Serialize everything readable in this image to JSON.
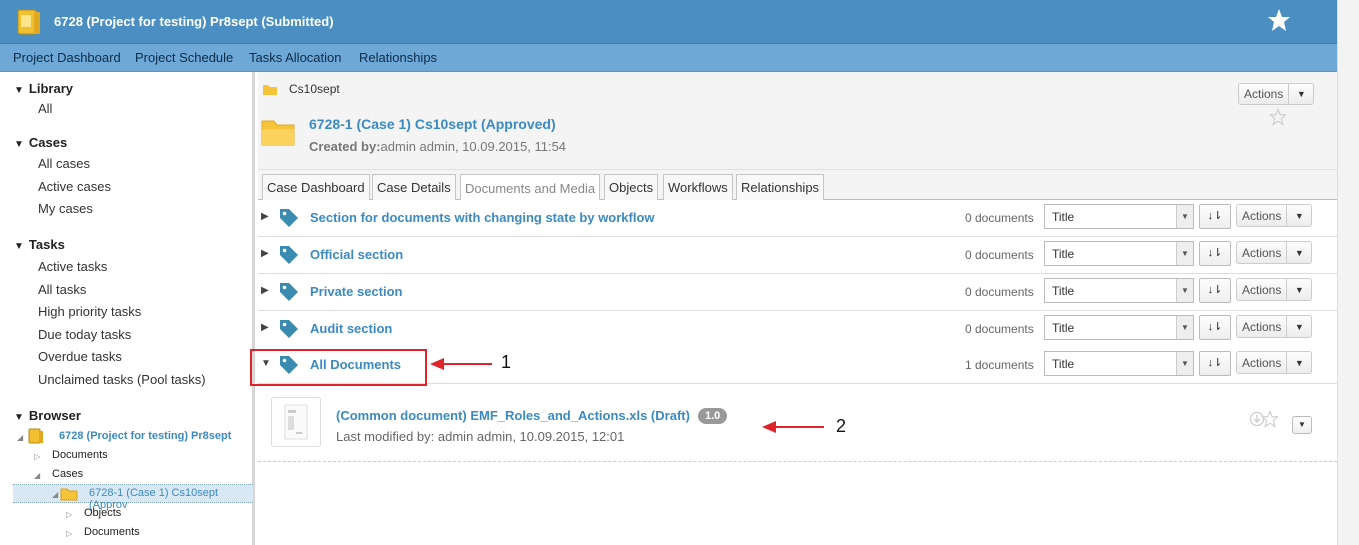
{
  "header": {
    "title": "6728 (Project for testing) Pr8sept (Submitted)"
  },
  "nav": [
    "Project Dashboard",
    "Project Schedule",
    "Tasks Allocation",
    "Relationships"
  ],
  "sidebar": {
    "library": {
      "title": "Library",
      "items": [
        "All"
      ]
    },
    "cases": {
      "title": "Cases",
      "items": [
        "All cases",
        "Active cases",
        "My cases"
      ]
    },
    "tasks": {
      "title": "Tasks",
      "items": [
        "Active tasks",
        "All tasks",
        "High priority tasks",
        "Due today tasks",
        "Overdue tasks",
        "Unclaimed tasks (Pool tasks)"
      ]
    },
    "browser": {
      "title": "Browser",
      "project": "6728 (Project for testing) Pr8sept",
      "documents": "Documents",
      "cases": "Cases",
      "case": "6728-1 (Case 1) Cs10sept (Approv",
      "objects": "Objects",
      "case_documents": "Documents"
    }
  },
  "case": {
    "breadcrumb": "Cs10sept",
    "title": "6728-1 (Case 1) Cs10sept (Approved)",
    "created_label": "Created by:",
    "created_value": "admin admin, 10.09.2015, 11:54",
    "actions_label": "Actions"
  },
  "tabs": [
    "Case Dashboard",
    "Case Details",
    "Documents and Media",
    "Objects",
    "Workflows",
    "Relationships"
  ],
  "sections": [
    {
      "name": "Section for documents with changing state by workflow",
      "count": "0 documents",
      "sort": "Title",
      "actions": "Actions",
      "expanded": false
    },
    {
      "name": "Official section",
      "count": "0 documents",
      "sort": "Title",
      "actions": "Actions",
      "expanded": false
    },
    {
      "name": "Private section",
      "count": "0 documents",
      "sort": "Title",
      "actions": "Actions",
      "expanded": false
    },
    {
      "name": "Audit section",
      "count": "0 documents",
      "sort": "Title",
      "actions": "Actions",
      "expanded": false
    },
    {
      "name": "All Documents",
      "count": "1 documents",
      "sort": "Title",
      "actions": "Actions",
      "expanded": true
    }
  ],
  "document": {
    "title": "(Common document) EMF_Roles_and_Actions.xls (Draft)",
    "version": "1.0",
    "meta": "Last modified by: admin admin, 10.09.2015, 12:01"
  },
  "annotations": [
    "1",
    "2"
  ],
  "colors": {
    "accent": "#3b8ac4",
    "topbar": "#4b8fc2",
    "navbar": "#6ea8d6",
    "annotation": "#e0242b",
    "tag": "#3a8bb0"
  }
}
